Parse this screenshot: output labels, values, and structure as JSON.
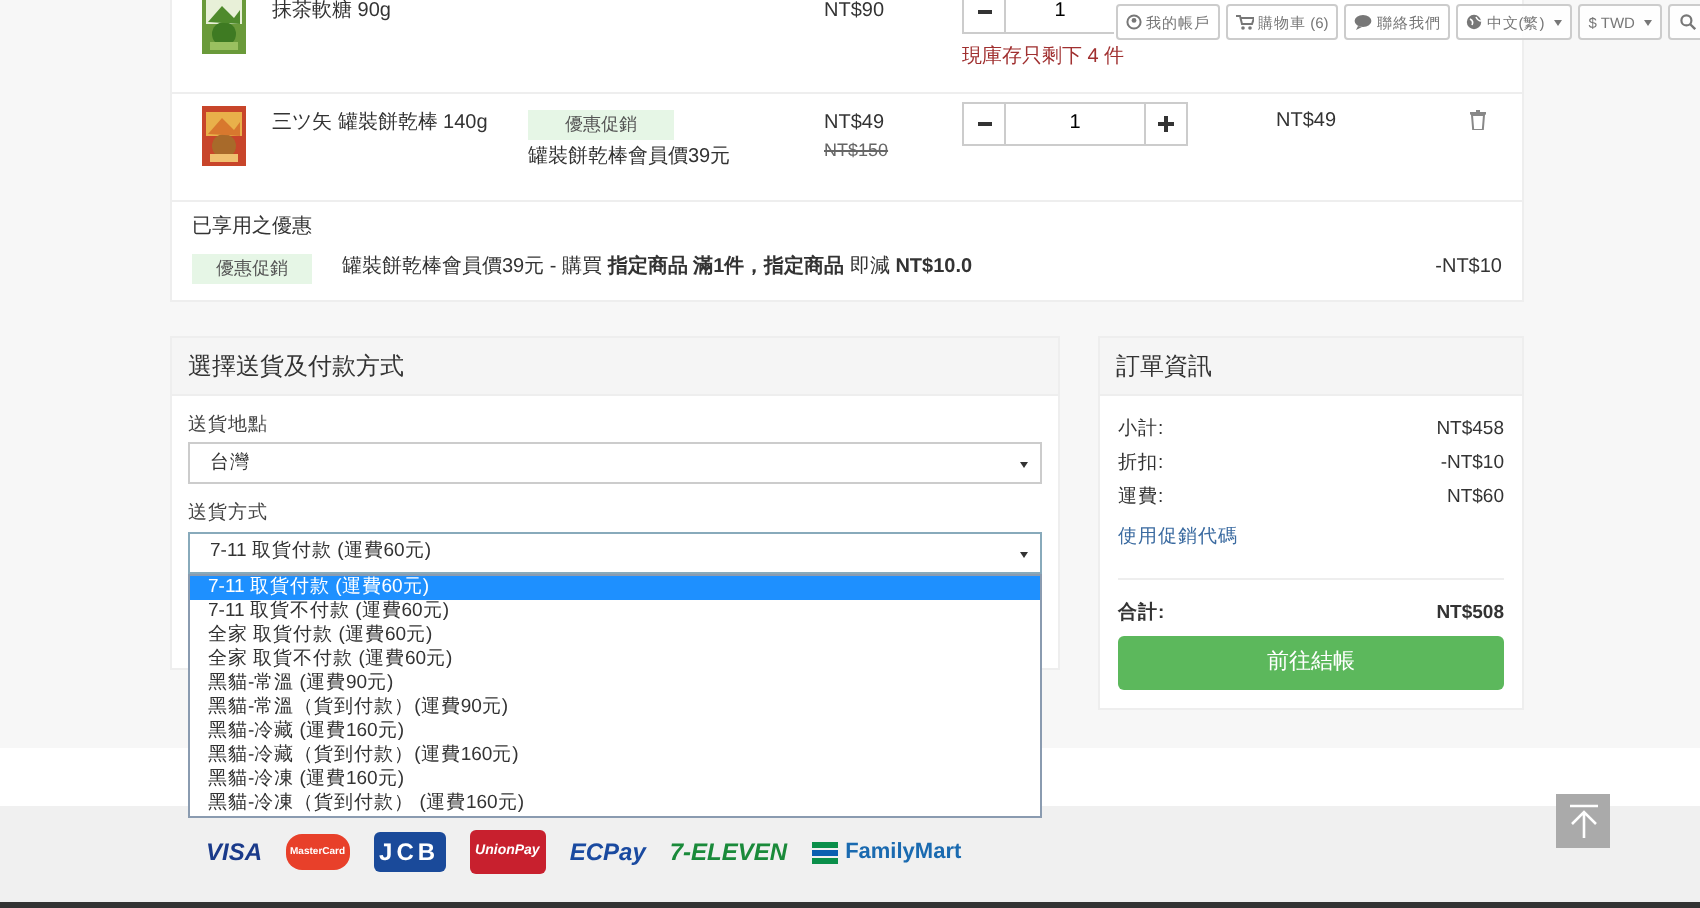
{
  "toolbar": [
    {
      "kind": "account",
      "label": "我的帳戶"
    },
    {
      "kind": "cart",
      "label": "購物車 (6)"
    },
    {
      "kind": "contact",
      "label": "聯絡我們"
    },
    {
      "kind": "language",
      "label": "中文(繁)"
    },
    {
      "kind": "currency",
      "label": "$ TWD"
    },
    {
      "kind": "search"
    }
  ],
  "cart": {
    "items": [
      {
        "name": "抹茶軟糖 90g",
        "price": "NT$90",
        "quantity": "1",
        "stock_warning": "現庫存只剩下 4 件"
      },
      {
        "name": "三ツ矢 罐裝餅乾棒 140g",
        "promo_tag": "優惠促銷",
        "promo_text": "罐裝餅乾棒會員價39元",
        "price": "NT$49",
        "original_price": "NT$150",
        "quantity": "1",
        "subtotal": "NT$49"
      }
    ],
    "discounts_title": "已享用之優惠",
    "discounts": [
      {
        "tag": "優惠促銷",
        "text": "罐裝餅乾棒會員價39元 - 購買 **指定商品 滿1件，指定商品** 即減 **NT$10.0**",
        "amount": "-NT$10"
      }
    ]
  },
  "shipping": {
    "title": "選擇送貨及付款方式",
    "location_label": "送貨地點",
    "location": "台灣",
    "method_label": "送貨方式",
    "method": "7-11 取貨付款 (運費60元)",
    "options": [
      {
        "label": "7-11 取貨付款 (運費60元)",
        "selected": true
      },
      {
        "label": "7-11 取貨不付款 (運費60元)",
        "selected": false
      },
      {
        "label": "全家 取貨付款 (運費60元)",
        "selected": false
      },
      {
        "label": "全家 取貨不付款 (運費60元)",
        "selected": false
      },
      {
        "label": "黑貓-常溫 (運費90元)",
        "selected": false
      },
      {
        "label": "黑貓-常溫（貨到付款）(運費90元)",
        "selected": false
      },
      {
        "label": "黑貓-冷藏 (運費160元)",
        "selected": false
      },
      {
        "label": "黑貓-冷藏（貨到付款）(運費160元)",
        "selected": false
      },
      {
        "label": "黑貓-冷凍 (運費160元)",
        "selected": false
      },
      {
        "label": "黑貓-冷凍（貨到付款） (運費160元)",
        "selected": false
      }
    ]
  },
  "summary": {
    "title": "訂單資訊",
    "rows": [
      {
        "label": "小計:",
        "value": "NT$458"
      },
      {
        "label": "折扣:",
        "value": "-NT$10"
      },
      {
        "label": "運費:",
        "value": "NT$60"
      }
    ],
    "coupon_link": "使用促銷代碼",
    "total_label": "合計:",
    "total": "NT$508",
    "checkout": "前往結帳"
  },
  "footer": {
    "payment_logos": [
      {
        "kind": "visa",
        "label": "VISA"
      },
      {
        "kind": "mastercard",
        "label": "MasterCard"
      },
      {
        "kind": "jcb",
        "label": "JCB"
      },
      {
        "kind": "unionpay",
        "label": "UnionPay"
      },
      {
        "kind": "ecpay",
        "label": "ECPay"
      },
      {
        "kind": "seven",
        "label": "7-ELEVEN"
      },
      {
        "kind": "familymart",
        "label": "FamilyMart"
      }
    ]
  }
}
